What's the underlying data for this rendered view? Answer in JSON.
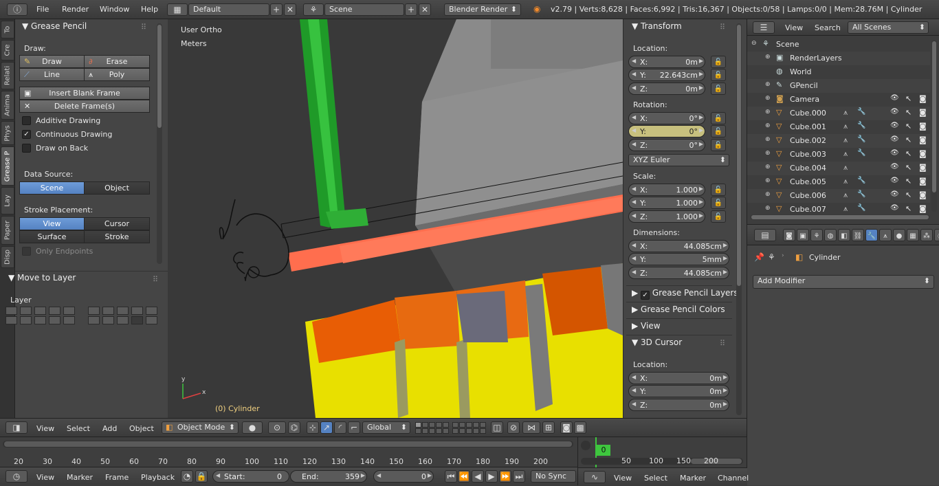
{
  "topbar": {
    "menus": [
      "File",
      "Render",
      "Window",
      "Help"
    ],
    "layout": "Default",
    "scene": "Scene",
    "engine": "Blender Render",
    "stats": "v2.79 | Verts:8,628 | Faces:6,992 | Tris:16,367 | Objects:0/58 | Lamps:0/0 | Mem:28.76M | Cylinder"
  },
  "tabs": [
    "Disp",
    "Paper",
    "Lay",
    "Grease P",
    "Phys",
    "Anima",
    "Relati",
    "Cre",
    "To"
  ],
  "grease_pencil": {
    "title": "Grease Pencil",
    "draw_label": "Draw:",
    "draw": "Draw",
    "erase": "Erase",
    "line": "Line",
    "poly": "Poly",
    "insert_blank": "Insert Blank Frame",
    "delete_frames": "Delete Frame(s)",
    "additive": "Additive Drawing",
    "continuous": "Continuous Drawing",
    "draw_on_back": "Draw on Back",
    "data_source_label": "Data Source:",
    "ds_scene": "Scene",
    "ds_object": "Object",
    "stroke_placement_label": "Stroke Placement:",
    "sp_view": "View",
    "sp_cursor": "Cursor",
    "sp_surface": "Surface",
    "sp_stroke": "Stroke",
    "only_endpoints": "Only Endpoints"
  },
  "move_to_layer": {
    "title": "Move to Layer",
    "layer_label": "Layer"
  },
  "viewport": {
    "view_name": "User Ortho",
    "units": "Meters",
    "object_label": "(0) Cylinder",
    "axis_x": "x",
    "axis_y": "y"
  },
  "transform": {
    "title": "Transform",
    "location_label": "Location:",
    "loc_x": "0m",
    "loc_y": "22.643cm",
    "loc_z": "0m",
    "rotation_label": "Rotation:",
    "rot_x": "0°",
    "rot_y": "0°",
    "rot_z": "0°",
    "rotation_mode": "XYZ Euler",
    "scale_label": "Scale:",
    "scale_x": "1.000",
    "scale_y": "1.000",
    "scale_z": "1.000",
    "dimensions_label": "Dimensions:",
    "dim_x": "44.085cm",
    "dim_y": "5mm",
    "dim_z": "44.085cm",
    "gp_layers": "Grease Pencil Layers",
    "gp_colors": "Grease Pencil Colors",
    "view_panel": "View",
    "cursor_panel": "3D Cursor",
    "cursor_location_label": "Location:",
    "cursor_x": "0m",
    "cursor_y": "0m",
    "cursor_z": "0m",
    "axis_x": "X:",
    "axis_y": "Y:",
    "axis_z": "Z:"
  },
  "outliner": {
    "view": "View",
    "search": "Search",
    "filter": "All Scenes",
    "items": [
      "Scene",
      "RenderLayers",
      "World",
      "GPencil",
      "Camera",
      "Cube.000",
      "Cube.001",
      "Cube.002",
      "Cube.003",
      "Cube.004",
      "Cube.005",
      "Cube.006",
      "Cube.007"
    ]
  },
  "properties": {
    "object_name": "Cylinder",
    "add_modifier": "Add Modifier"
  },
  "view3d_header": {
    "menus": [
      "View",
      "Select",
      "Add",
      "Object"
    ],
    "mode": "Object Mode",
    "orientation": "Global"
  },
  "timeline": {
    "ticks": [
      "20",
      "30",
      "40",
      "50",
      "60",
      "70",
      "80",
      "90",
      "100",
      "110",
      "120",
      "130",
      "140",
      "150",
      "160",
      "170",
      "180",
      "190",
      "200"
    ],
    "menus": [
      "View",
      "Marker",
      "Frame",
      "Playback"
    ],
    "start_label": "Start:",
    "start": "0",
    "end_label": "End:",
    "end": "359",
    "current": "0",
    "sync": "No Sync"
  },
  "graph": {
    "current_frame": "0",
    "ticks": [
      "50",
      "100",
      "150",
      "200"
    ],
    "menus": [
      "View",
      "Select",
      "Marker",
      "Channel"
    ]
  },
  "colors": {
    "accent_blue": "#5582c2",
    "green_frame": "#3ec63e",
    "highlight_field": "#c7c07e"
  }
}
